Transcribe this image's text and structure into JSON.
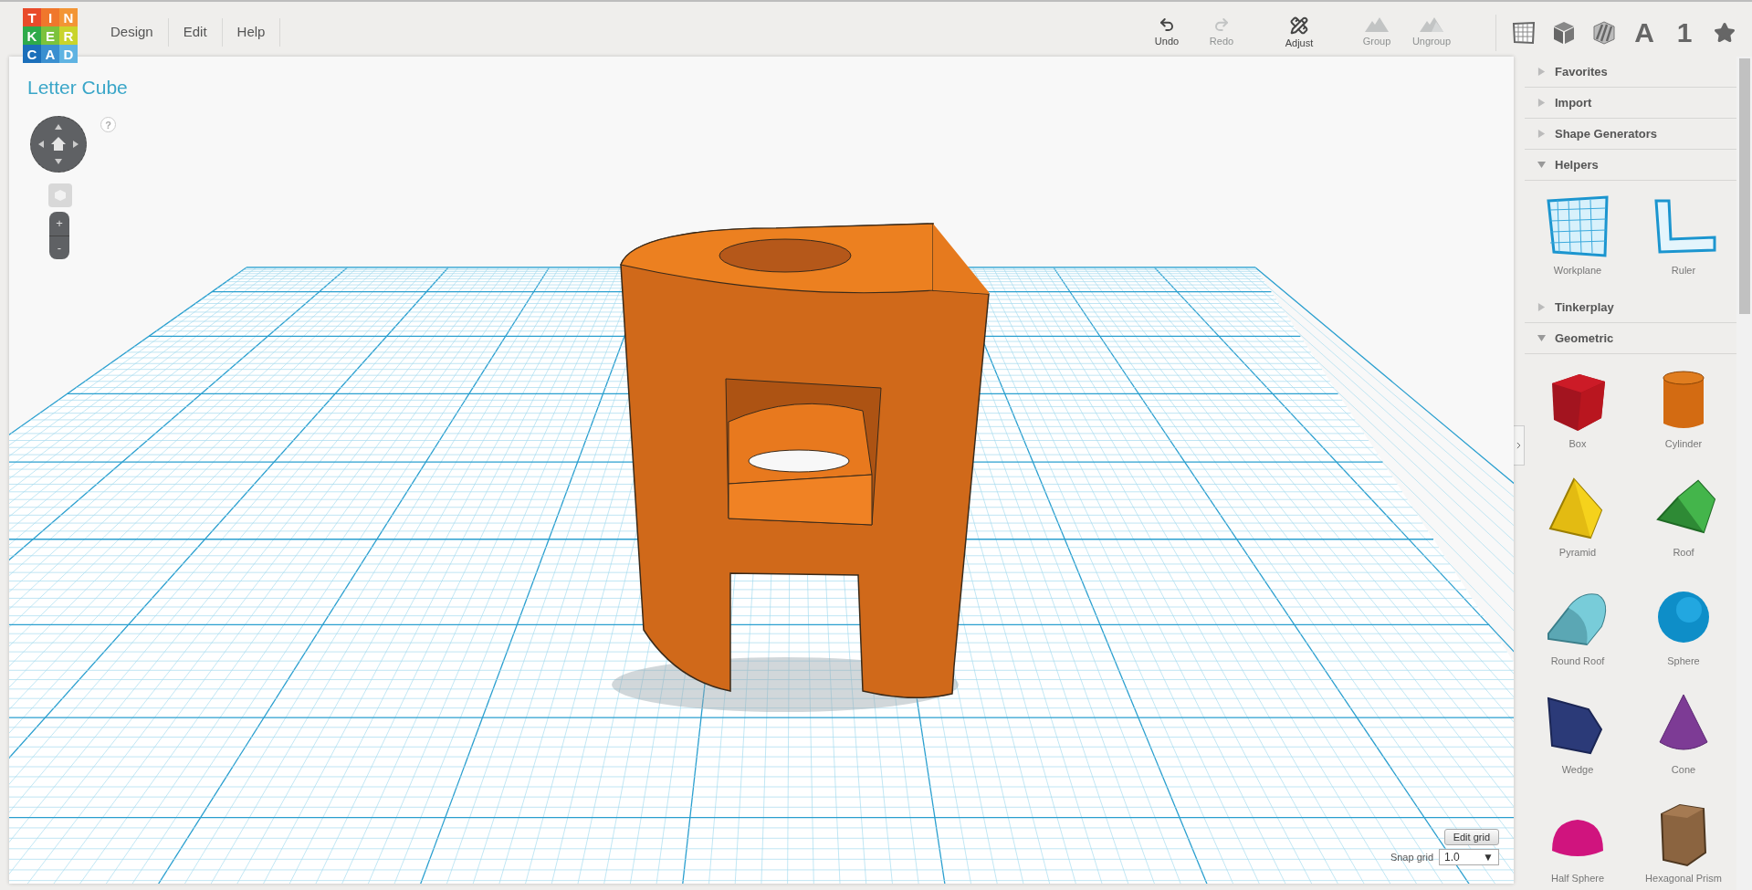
{
  "logo": {
    "letters": [
      {
        "text": "T",
        "color": "#e94b2b"
      },
      {
        "text": "I",
        "color": "#f0772c"
      },
      {
        "text": "N",
        "color": "#f39535"
      },
      {
        "text": "K",
        "color": "#2eaa4a"
      },
      {
        "text": "E",
        "color": "#7cc23c"
      },
      {
        "text": "R",
        "color": "#c9d42c"
      },
      {
        "text": "C",
        "color": "#1b6fba"
      },
      {
        "text": "A",
        "color": "#3a8fd0"
      },
      {
        "text": "D",
        "color": "#5fb3e2"
      }
    ]
  },
  "menu": [
    "Design",
    "Edit",
    "Help"
  ],
  "toolbar": {
    "actions": [
      {
        "label": "Undo",
        "kind": "undo",
        "disabled": false
      },
      {
        "label": "Redo",
        "kind": "redo",
        "disabled": true
      },
      {
        "label": "Adjust",
        "kind": "adjust",
        "disabled": false
      },
      {
        "label": "Group",
        "kind": "group",
        "disabled": true
      },
      {
        "label": "Ungroup",
        "kind": "ungroup",
        "disabled": true
      }
    ],
    "views": [
      {
        "kind": "grid"
      },
      {
        "kind": "solid"
      },
      {
        "kind": "hole"
      },
      {
        "kind": "text",
        "label": "A"
      },
      {
        "kind": "text",
        "label": "1"
      },
      {
        "kind": "star"
      }
    ]
  },
  "canvas": {
    "title": "Letter Cube",
    "help": "?",
    "zoom_in": "+",
    "zoom_out": "-",
    "edit_grid": "Edit grid",
    "snap_grid": {
      "label": "Snap grid",
      "value": "1.0",
      "caret": "▼"
    }
  },
  "panel": {
    "categories": [
      {
        "title": "Favorites",
        "expanded": false
      },
      {
        "title": "Import",
        "expanded": false
      },
      {
        "title": "Shape Generators",
        "expanded": false
      },
      {
        "title": "Helpers",
        "expanded": true,
        "items": [
          {
            "label": "Workplane",
            "kind": "workplane"
          },
          {
            "label": "Ruler",
            "kind": "ruler"
          }
        ]
      },
      {
        "title": "Tinkerplay",
        "expanded": false
      },
      {
        "title": "Geometric",
        "expanded": true,
        "items": [
          {
            "label": "Box",
            "kind": "box"
          },
          {
            "label": "Cylinder",
            "kind": "cylinder"
          },
          {
            "label": "Pyramid",
            "kind": "pyramid"
          },
          {
            "label": "Roof",
            "kind": "roof"
          },
          {
            "label": "Round Roof",
            "kind": "roundroof"
          },
          {
            "label": "Sphere",
            "kind": "sphere"
          },
          {
            "label": "Wedge",
            "kind": "wedge"
          },
          {
            "label": "Cone",
            "kind": "cone"
          },
          {
            "label": "Half Sphere",
            "kind": "halfsphere"
          },
          {
            "label": "Hexagonal Prism",
            "kind": "hexprism"
          }
        ]
      }
    ]
  }
}
